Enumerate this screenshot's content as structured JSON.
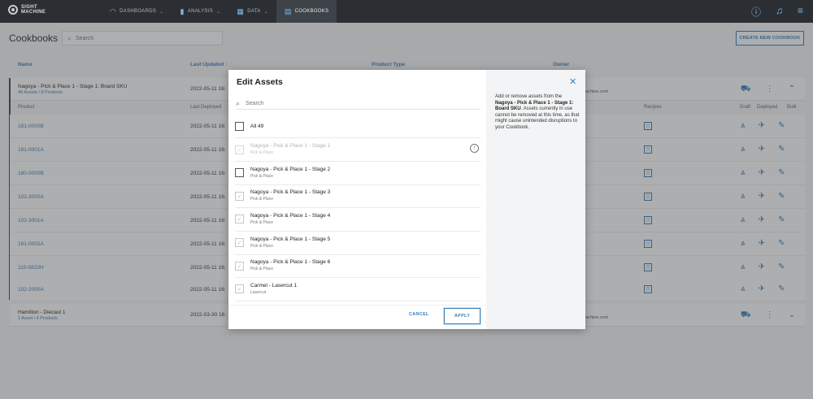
{
  "topbar": {
    "logo_text": "SIGHT MACHINE",
    "nav": [
      {
        "label": "DASHBOARDS",
        "icon": "gauge-icon",
        "active": false
      },
      {
        "label": "ANALYSIS",
        "icon": "bar-chart-icon",
        "active": false
      },
      {
        "label": "DATA",
        "icon": "grid-icon",
        "active": false
      },
      {
        "label": "COOKBOOKS",
        "icon": "book-icon",
        "active": true
      }
    ]
  },
  "page": {
    "title": "Cookbooks",
    "search_placeholder": "Search",
    "create_button": "CREATE NEW COOKBOOK"
  },
  "table": {
    "headers": {
      "name": "Name",
      "last_updated": "Last Updated",
      "product_type": "Product Type",
      "owner": "Owner"
    },
    "group1": {
      "name": "Nagoya - Pick & Place 1 - Stage 1: Board SKU",
      "subtitle": "49 Assets / 8 Products",
      "date": "2022-05-11 16:",
      "owner_tail": "nachine.com"
    },
    "subheaders": {
      "product": "Product",
      "last_deployed": "Last Deployed",
      "recipes": "Recipes",
      "draft": "Draft",
      "deployed": "Deployed",
      "bulk": "Bulk"
    },
    "products": [
      {
        "name": "181-0000B",
        "date": "2022-05-11 16:"
      },
      {
        "name": "181-0001A",
        "date": "2022-05-11 16:"
      },
      {
        "name": "180-0000B",
        "date": "2022-05-11 16:"
      },
      {
        "name": "102-3000A",
        "date": "2022-05-11 16:"
      },
      {
        "name": "102-3001A",
        "date": "2022-05-11 16:"
      },
      {
        "name": "181-0002A",
        "date": "2022-05-11 16:"
      },
      {
        "name": "110-0820H",
        "date": "2022-05-11 16:"
      },
      {
        "name": "102-2000A",
        "date": "2022-05-11 16:"
      }
    ],
    "group2": {
      "name": "Hamilton - Diecast 1",
      "subtitle": "1 Asset / 4 Products",
      "date": "2022-03-30 16:",
      "owner_tail": "nachine.com"
    }
  },
  "modal": {
    "title": "Edit Assets",
    "search_placeholder": "Search",
    "all_label": "All 49",
    "help_intro": "Add or remove assets from the",
    "help_bold": "Nagoya - Pick & Place 1 - Stage 1: Board SKU",
    "help_rest": ". Assets currently in use cannot be removed at this time, as that might cause unintended disruptions to your Cookbook.",
    "items": [
      {
        "name": "Nagoya - Pick & Place 1 - Stage 1",
        "sub": "Pick & Place",
        "state": "disabled"
      },
      {
        "name": "Nagoya - Pick & Place 1 - Stage 2",
        "sub": "Pick & Place",
        "state": "unchecked"
      },
      {
        "name": "Nagoya - Pick & Place 1 - Stage 3",
        "sub": "Pick & Place",
        "state": "checked"
      },
      {
        "name": "Nagoya - Pick & Place 1 - Stage 4",
        "sub": "Pick & Place",
        "state": "checked"
      },
      {
        "name": "Nagoya - Pick & Place 1 - Stage 5",
        "sub": "Pick & Place",
        "state": "checked"
      },
      {
        "name": "Nagoya - Pick & Place 1 - Stage 6",
        "sub": "Pick & Place",
        "state": "checked"
      },
      {
        "name": "Carmel - Lasercut 1",
        "sub": "Lasercut",
        "state": "checked"
      }
    ],
    "cancel_label": "CANCEL",
    "apply_label": "APPLY"
  }
}
